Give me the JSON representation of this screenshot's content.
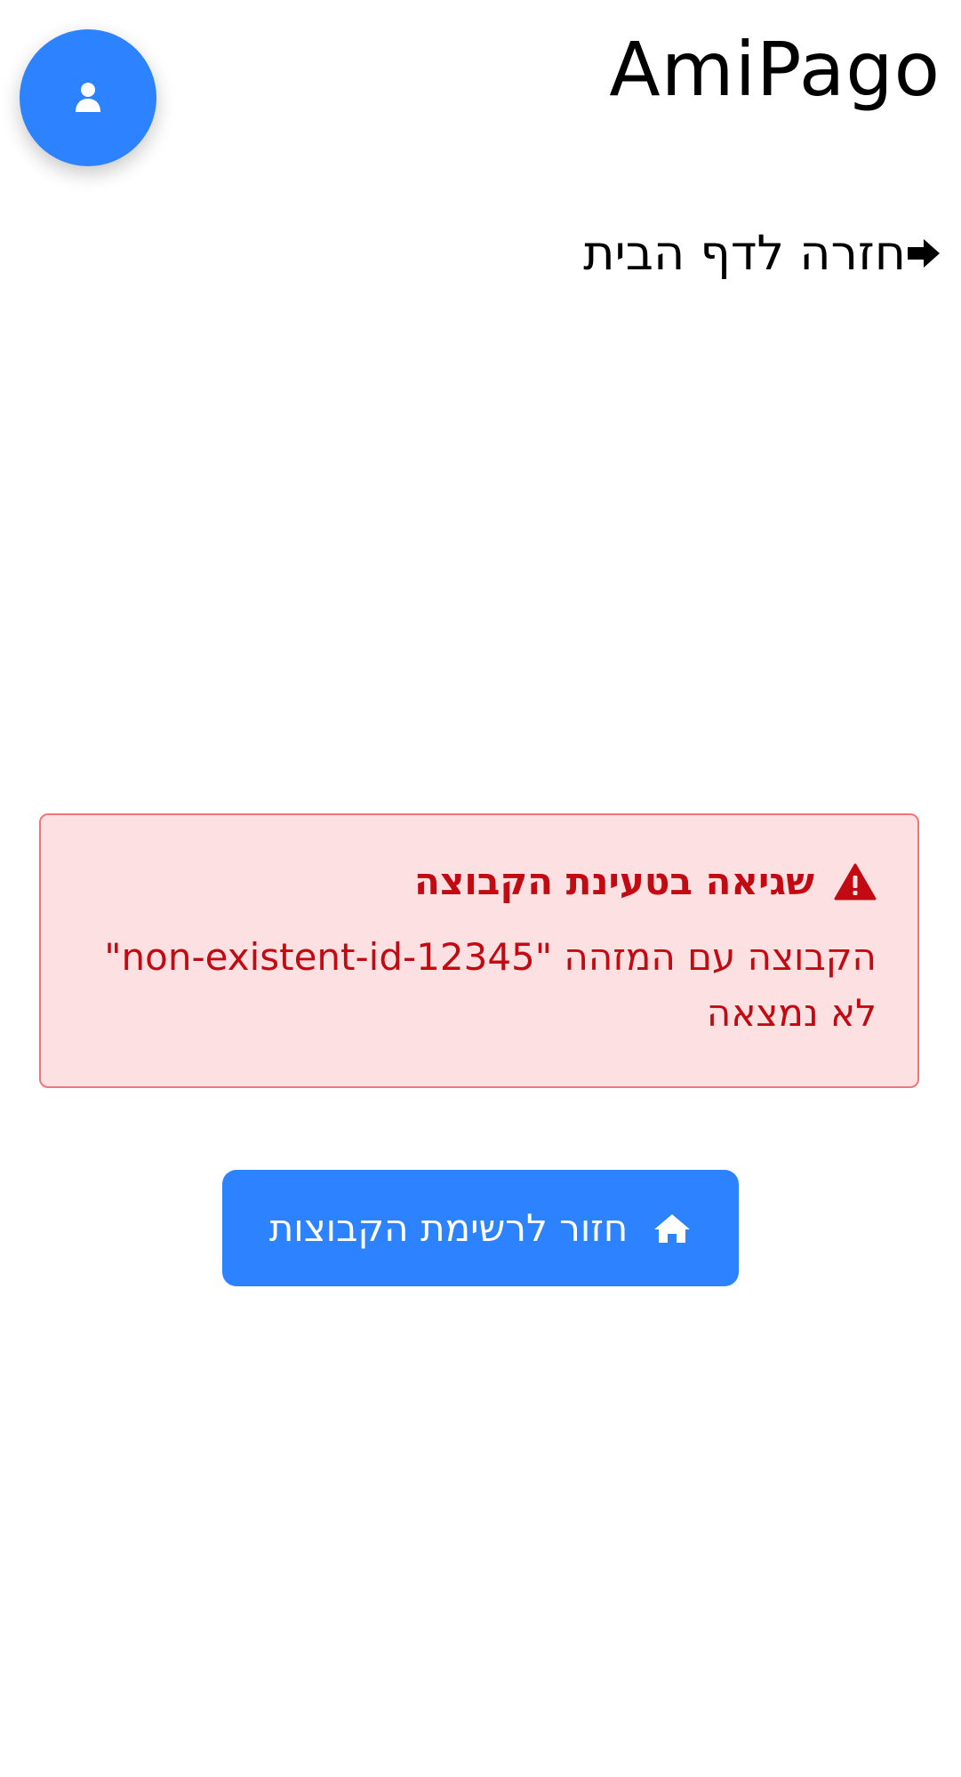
{
  "header": {
    "app_title": "AmiPago",
    "profile_icon": "user-icon"
  },
  "navigation": {
    "back_home_label": "חזרה לדף הבית",
    "back_icon": "arrow-right-icon"
  },
  "error": {
    "icon": "warning-triangle-icon",
    "title": "שגיאה בטעינת הקבוצה",
    "message": "הקבוצה עם המזהה \"non-existent-id-12345\" לא נמצאה"
  },
  "actions": {
    "back_to_groups_label": "חזור לרשימת הקבוצות",
    "back_to_groups_icon": "home-icon"
  },
  "colors": {
    "primary": "#2d82ff",
    "error_text": "#c20a12",
    "error_bg": "#fde0e2",
    "error_border": "#f0767c"
  }
}
